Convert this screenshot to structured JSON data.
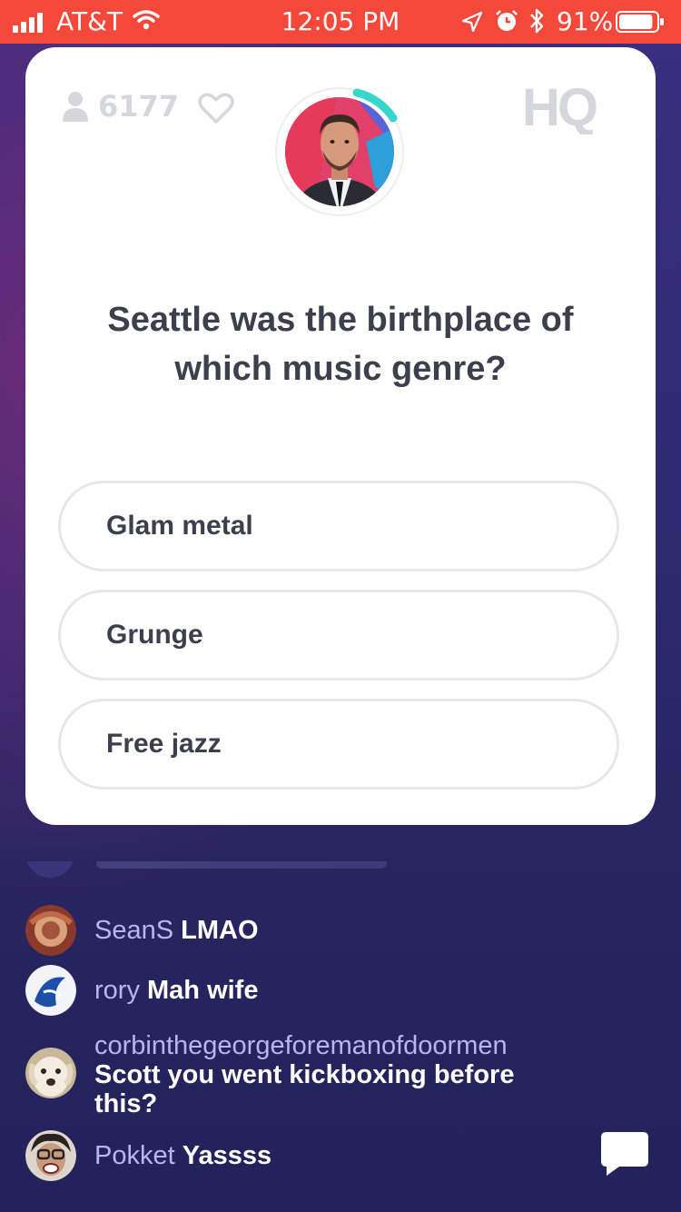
{
  "status_bar": {
    "carrier": "AT&T",
    "time": "12:05 PM",
    "battery_percent": "91%",
    "battery_level": 0.91,
    "icons": [
      "signal-icon",
      "wifi-icon",
      "location-icon",
      "alarm-icon",
      "bluetooth-icon",
      "battery-icon"
    ]
  },
  "game": {
    "viewer_count": "6177",
    "logo_text": "HQ",
    "question": "Seattle was the birthplace of which music genre?",
    "answers": [
      "Glam metal",
      "Grunge",
      "Free jazz"
    ]
  },
  "chat": {
    "messages": [
      {
        "user": "SeanS",
        "text": "LMAO"
      },
      {
        "user": "rory",
        "text": "Mah wife"
      },
      {
        "user": "corbinthegeorgeforemanofdoormen",
        "text": "Scott you went kickboxing before this?"
      },
      {
        "user": "Pokket",
        "text": "Yassss"
      }
    ]
  },
  "colors": {
    "status_bar": "#f4483a",
    "accent_teal": "#3ad6c9",
    "question_text": "#3c3f4c",
    "chat_username": "#b8b6ee"
  }
}
